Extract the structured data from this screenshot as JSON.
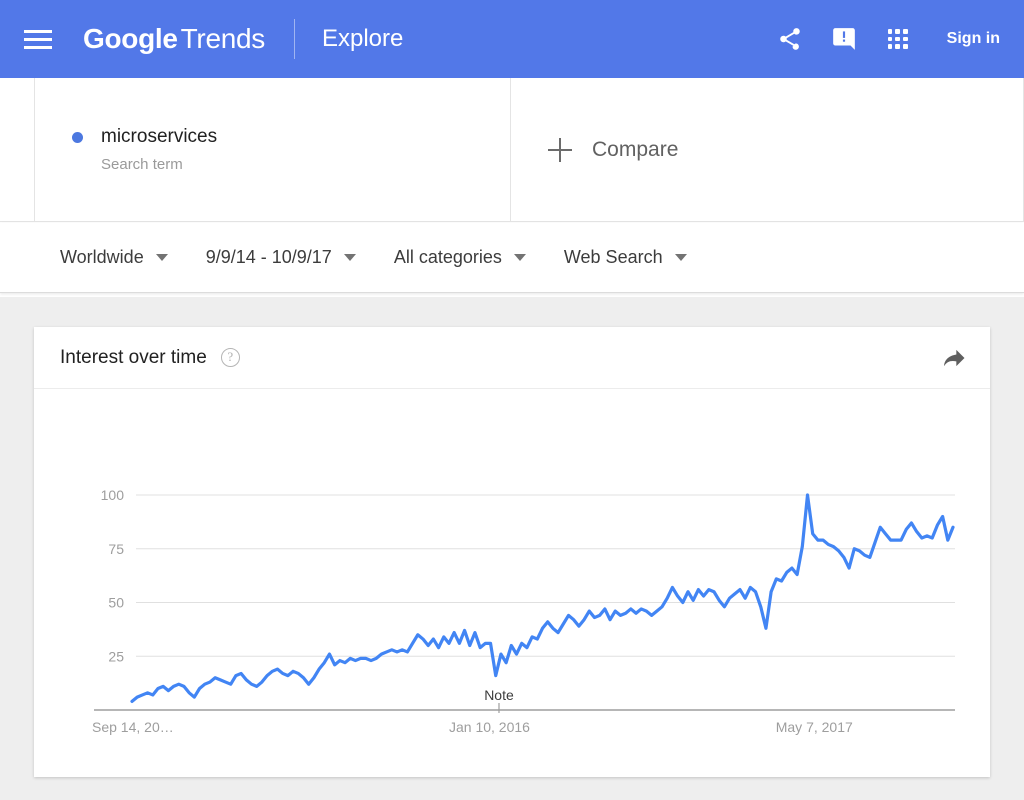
{
  "appbar": {
    "menu_icon": "hamburger-menu-icon",
    "brand_google": "Google",
    "brand_trends": "Trends",
    "section": "Explore",
    "share_icon": "share-icon",
    "feedback_icon": "feedback-icon",
    "apps_icon": "apps-grid-icon",
    "sign_in": "Sign in",
    "background_color": "#5278e8"
  },
  "query": {
    "term": "microservices",
    "term_type": "Search term",
    "dot_color": "#4c78e0",
    "compare_label": "Compare",
    "compare_icon": "plus-icon"
  },
  "filters": [
    {
      "label": "Worldwide"
    },
    {
      "label": "9/9/14 - 10/9/17"
    },
    {
      "label": "All categories"
    },
    {
      "label": "Web Search"
    }
  ],
  "card": {
    "title": "Interest over time",
    "help_icon": "help-circle-icon",
    "share_icon": "share-forward-icon"
  },
  "chart_data": {
    "type": "line",
    "title": "Interest over time",
    "xlabel": "",
    "ylabel": "",
    "ylim": [
      0,
      100
    ],
    "yticks": [
      25,
      50,
      75,
      100
    ],
    "grid": true,
    "legend": false,
    "line_color": "#4285f4",
    "x_tick_labels": [
      "Sep 14, 20…",
      "Jan 10, 2016",
      "May 7, 2017"
    ],
    "x_tick_positions": [
      0,
      0.447,
      0.845
    ],
    "annotations": [
      {
        "label": "Note",
        "x_position": 0.447
      }
    ],
    "series": [
      {
        "name": "microservices",
        "values": [
          4,
          6,
          7,
          8,
          7,
          10,
          11,
          9,
          11,
          12,
          11,
          8,
          6,
          10,
          12,
          13,
          15,
          14,
          13,
          12,
          16,
          17,
          14,
          12,
          11,
          13,
          16,
          18,
          19,
          17,
          16,
          18,
          17,
          15,
          12,
          15,
          19,
          22,
          26,
          21,
          23,
          22,
          24,
          23,
          24,
          24,
          23,
          24,
          26,
          27,
          28,
          27,
          28,
          27,
          31,
          35,
          33,
          30,
          33,
          29,
          34,
          31,
          36,
          31,
          37,
          30,
          36,
          29,
          31,
          31,
          16,
          26,
          22,
          30,
          26,
          31,
          29,
          34,
          33,
          38,
          41,
          38,
          36,
          40,
          44,
          42,
          39,
          42,
          46,
          43,
          44,
          47,
          42,
          46,
          44,
          45,
          47,
          45,
          47,
          46,
          44,
          46,
          48,
          52,
          57,
          53,
          50,
          55,
          51,
          56,
          53,
          56,
          55,
          51,
          48,
          52,
          54,
          56,
          52,
          57,
          55,
          48,
          38,
          55,
          61,
          60,
          64,
          66,
          63,
          76,
          100,
          82,
          79,
          79,
          77,
          76,
          74,
          71,
          66,
          75,
          74,
          72,
          71,
          78,
          85,
          82,
          79,
          79,
          79,
          84,
          87,
          83,
          80,
          81,
          80,
          86,
          90,
          79,
          85
        ]
      }
    ]
  }
}
